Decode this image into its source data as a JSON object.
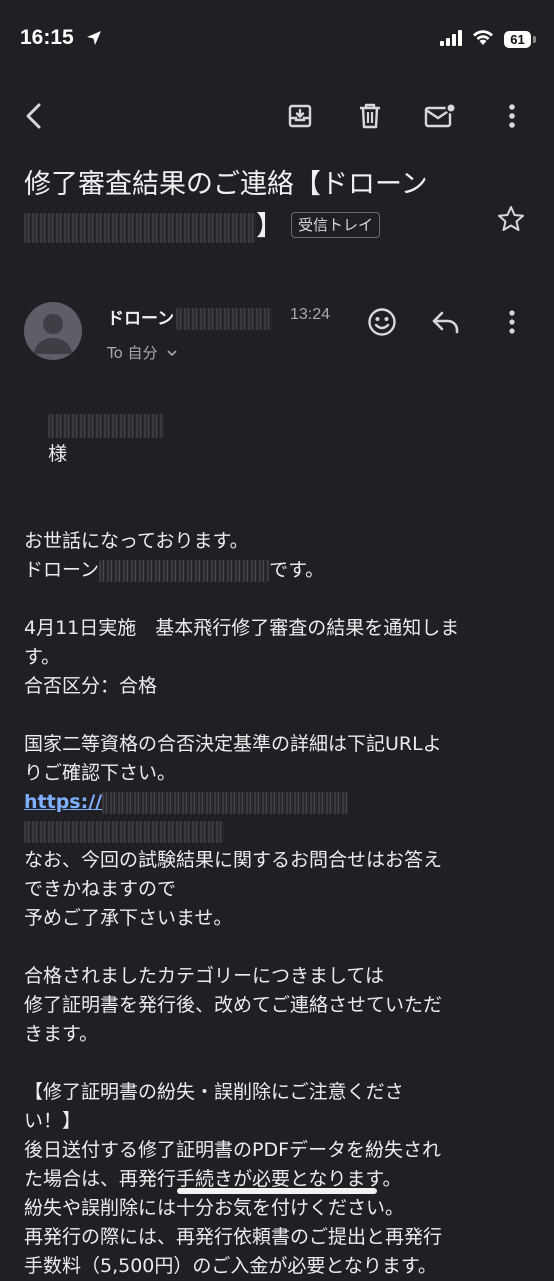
{
  "status_bar": {
    "time": "16:15",
    "battery": "61"
  },
  "toolbar": {
    "back_icon": "chevron-left-icon",
    "archive_icon": "archive-icon",
    "delete_icon": "trash-icon",
    "mark_unread_icon": "mail-unread-icon",
    "more_icon": "more-vertical-icon"
  },
  "email": {
    "subject": "修了審査結果のご連絡【ドローン",
    "subject_end": "】",
    "label": "受信トレイ",
    "sender_name": "ドローン",
    "time": "13:24",
    "recipient": "To 自分",
    "salutation_suffix": "様",
    "body": {
      "greet1": "お世話になっております。",
      "greet2_prefix": "ドローン",
      "greet2_suffix": "です。",
      "line_result_notice": "4月11日実施　基本飛行修了審査の結果を通知しま\nす。",
      "line_result": "合否区分：合格",
      "line_criteria": "国家二等資格の合否決定基準の詳細は下記URLよ\nりご確認下さい。",
      "link_prefix": "https://",
      "line_inquiry": "なお、今回の試験結果に関するお問合せはお答え\nできかねますので\n予めご了承下さいませ。",
      "line_cert": "合格されましたカテゴリーにつきましては\n修了証明書を発行後、改めてご連絡させていただ\nきます。",
      "line_notice_title": "【修了証明書の紛失・誤削除にご注意くださ\nい！】",
      "line_notice_body": "後日送付する修了証明書のPDFデータを紛失され\nた場合は、再発行手続きが必要となります。\n紛失や誤削除には十分お気を付けください。\n再発行の際には、再発行依頼書のご提出と再発行\n手数料（5,500円）のご入金が必要となります。"
    }
  },
  "colors": {
    "background": "#1f1f24",
    "text": "#ececee",
    "link": "#7fb0ff",
    "muted": "#a8a8ae"
  }
}
